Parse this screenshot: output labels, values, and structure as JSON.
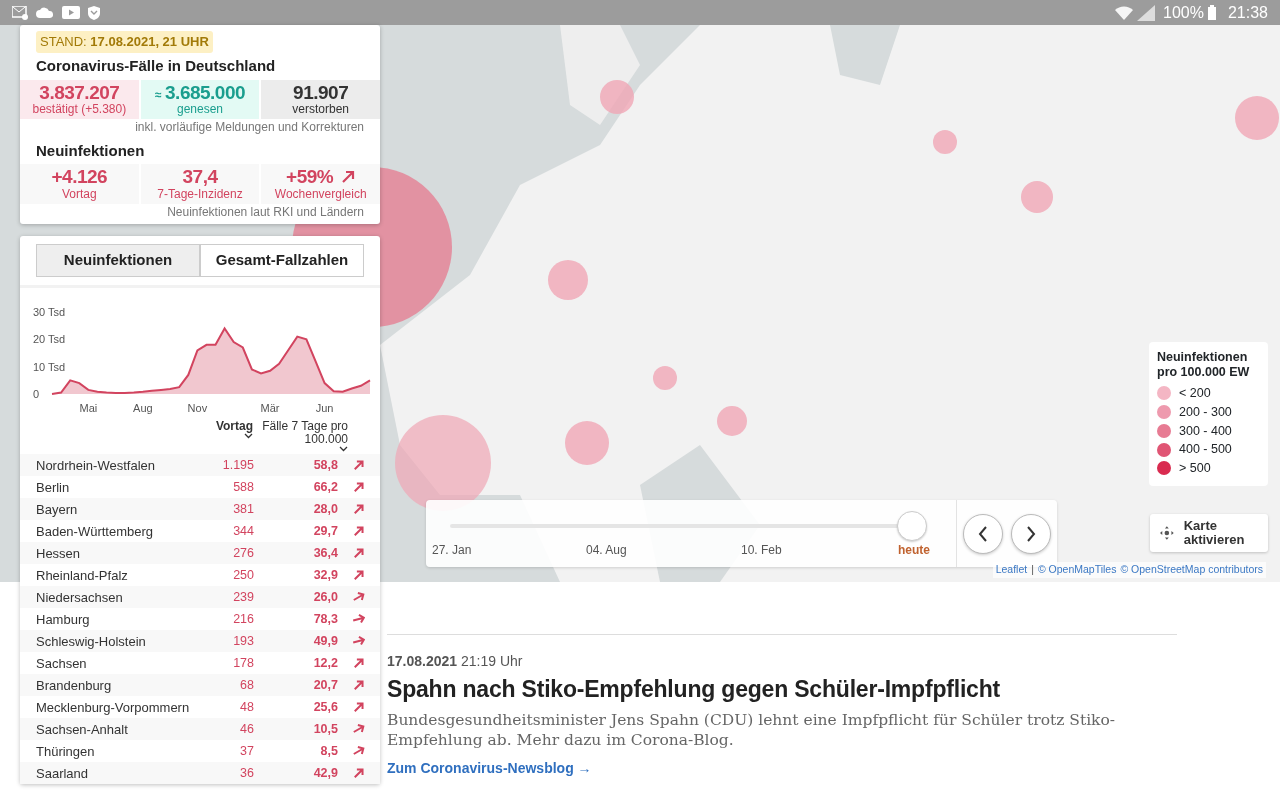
{
  "status_bar": {
    "battery": "100%",
    "time": "21:38"
  },
  "summary": {
    "stand": "STAND: **17.08.2021, 21 UHR**",
    "title": "Coronavirus-Fälle in Deutschland",
    "totals": [
      {
        "kind": "confirmed",
        "value": "3.837.207",
        "label": "bestätigt (+5.380)"
      },
      {
        "kind": "recovered",
        "prefix": "≈",
        "value": "3.685.000",
        "label": "genesen"
      },
      {
        "kind": "deaths",
        "value": "91.907",
        "label": "verstorben"
      }
    ],
    "totals_note": "inkl. vorläufige Meldungen und Korrekturen",
    "new_title": "Neuinfektionen",
    "new": [
      {
        "value": "+4.126",
        "label": "Vortag",
        "trend": false
      },
      {
        "value": "37,4",
        "label": "7-Tage-Inzidenz",
        "trend": false
      },
      {
        "value": "+59%",
        "label": "Wochenvergleich",
        "trend": true
      }
    ],
    "new_note": "Neuinfektionen laut RKI und Ländern"
  },
  "tabs": [
    {
      "label": "Neuinfektionen",
      "selected": true
    },
    {
      "label": "Gesamt-Fallzahlen",
      "selected": false
    }
  ],
  "chart_data": {
    "type": "area",
    "categories": [
      null,
      null,
      null,
      null,
      "Mai",
      null,
      null,
      null,
      null,
      null,
      "Aug",
      null,
      null,
      null,
      null,
      null,
      "Nov",
      null,
      null,
      null,
      null,
      null,
      null,
      null,
      "Mär",
      null,
      null,
      null,
      null,
      null,
      "Jun",
      null,
      null,
      null,
      null,
      null
    ],
    "series": [
      {
        "color": "#d2445f",
        "values": [
          0,
          0.5,
          5,
          4,
          1.5,
          0.8,
          0.5,
          0.4,
          0.4,
          0.5,
          0.8,
          1.2,
          1.5,
          1.8,
          2.5,
          7,
          16,
          18,
          18,
          24,
          19,
          17,
          9,
          7.5,
          8.5,
          11,
          16,
          21,
          20,
          12,
          4,
          1,
          0.8,
          2,
          3,
          5
        ]
      }
    ],
    "ylim": [
      0,
      30
    ],
    "yticks": [
      {
        "value": 0,
        "label": "0"
      },
      {
        "value": 10,
        "label": "10 Tsd"
      },
      {
        "value": 20,
        "label": "20 Tsd"
      },
      {
        "value": 30,
        "label": "30 Tsd"
      }
    ]
  },
  "table": {
    "columns": [
      {
        "label": "Vortag",
        "selected": true
      },
      {
        "label": "Fälle 7 Tage pro 100.000",
        "selected": false
      }
    ],
    "rows": [
      {
        "state": "Nordrhein-Westfalen",
        "vortag": "1.195",
        "incidence": "58,8",
        "kind": "steep"
      },
      {
        "state": "Berlin",
        "vortag": "588",
        "incidence": "66,2",
        "kind": "steep"
      },
      {
        "state": "Bayern",
        "vortag": "381",
        "incidence": "28,0",
        "kind": "steep"
      },
      {
        "state": "Baden-Württemberg",
        "vortag": "344",
        "incidence": "29,7",
        "kind": "steep"
      },
      {
        "state": "Hessen",
        "vortag": "276",
        "incidence": "36,4",
        "kind": "steep"
      },
      {
        "state": "Rheinland-Pfalz",
        "vortag": "250",
        "incidence": "32,9",
        "kind": "steep"
      },
      {
        "state": "Niedersachsen",
        "vortag": "239",
        "incidence": "26,0",
        "kind": "moderate"
      },
      {
        "state": "Hamburg",
        "vortag": "216",
        "incidence": "78,3",
        "kind": "flat"
      },
      {
        "state": "Schleswig-Holstein",
        "vortag": "193",
        "incidence": "49,9",
        "kind": "flat"
      },
      {
        "state": "Sachsen",
        "vortag": "178",
        "incidence": "12,2",
        "kind": "steep"
      },
      {
        "state": "Brandenburg",
        "vortag": "68",
        "incidence": "20,7",
        "kind": "steep"
      },
      {
        "state": "Mecklenburg-Vorpommern",
        "vortag": "48",
        "incidence": "25,6",
        "kind": "steep"
      },
      {
        "state": "Sachsen-Anhalt",
        "vortag": "46",
        "incidence": "10,5",
        "kind": "moderate"
      },
      {
        "state": "Thüringen",
        "vortag": "37",
        "incidence": "8,5",
        "kind": "moderate"
      },
      {
        "state": "Saarland",
        "vortag": "36",
        "incidence": "42,9",
        "kind": "steep"
      }
    ]
  },
  "legend": {
    "title": "Neuinfektionen pro 100.000 EW",
    "items": [
      {
        "label": "< 200",
        "color": "#f4b6c4"
      },
      {
        "label": "200 - 300",
        "color": "#ee9aae"
      },
      {
        "label": "300 - 400",
        "color": "#e77b93"
      },
      {
        "label": "400 - 500",
        "color": "#e05574"
      },
      {
        "label": "> 500",
        "color": "#d92b50"
      }
    ]
  },
  "timeline": {
    "labels": [
      "27. Jan",
      "04. Aug",
      "10. Feb"
    ],
    "current": "heute",
    "level": 1
  },
  "activate_button": "Karte aktivieren",
  "attribution": [
    {
      "kind": "link",
      "text": "Leaflet"
    },
    {
      "kind": "text",
      "text": "|"
    },
    {
      "kind": "link",
      "text": "© OpenMapTiles"
    },
    {
      "kind": "link",
      "text": "© OpenStreetMap contributors"
    }
  ],
  "article": {
    "date": "17.08.2021",
    "time": "21:19 Uhr",
    "headline": "Spahn nach Stiko-Empfehlung gegen Schüler-Impfpflicht",
    "teaser": "Bundesgesundheitsminister Jens Spahn (CDU) lehnt eine Impfpflicht für Schüler trotz Stiko-Empfehlung ab. Mehr dazu im Corona-Blog.",
    "link": "Zum Coronavirus-Newsblog →"
  }
}
